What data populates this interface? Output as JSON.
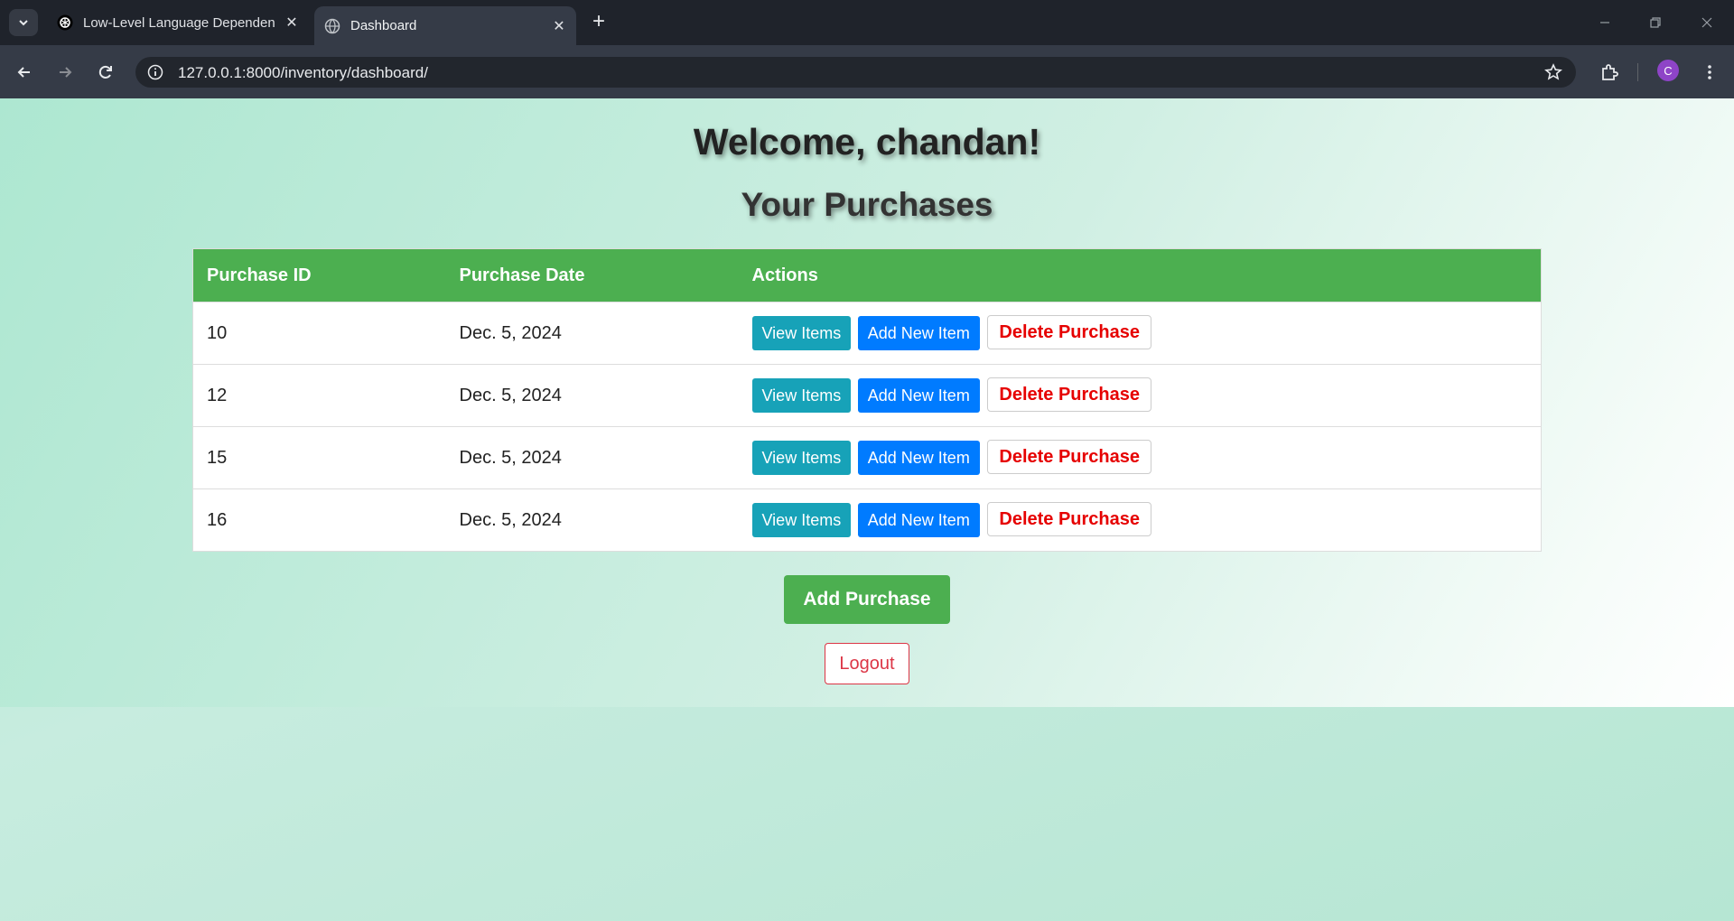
{
  "browser": {
    "tabs": [
      {
        "title": "Low-Level Language Dependen",
        "favicon": "openai-icon",
        "active": false
      },
      {
        "title": "Dashboard",
        "favicon": "globe-icon",
        "active": true
      }
    ],
    "url": "127.0.0.1:8000/inventory/dashboard/",
    "profile_initial": "C"
  },
  "page": {
    "welcome": "Welcome, chandan!",
    "subtitle": "Your Purchases",
    "table": {
      "headers": [
        "Purchase ID",
        "Purchase Date",
        "Actions"
      ],
      "rows": [
        {
          "id": "10",
          "date": "Dec. 5, 2024"
        },
        {
          "id": "12",
          "date": "Dec. 5, 2024"
        },
        {
          "id": "15",
          "date": "Dec. 5, 2024"
        },
        {
          "id": "16",
          "date": "Dec. 5, 2024"
        }
      ],
      "actions": {
        "view": "View Items",
        "add": "Add New Item",
        "delete": "Delete Purchase"
      }
    },
    "add_purchase": "Add Purchase",
    "logout": "Logout"
  },
  "colors": {
    "header_green": "#4caf50",
    "view_button": "#17a2b8",
    "add_button": "#007bff",
    "delete_text": "#e60000",
    "logout": "#dc3545"
  }
}
